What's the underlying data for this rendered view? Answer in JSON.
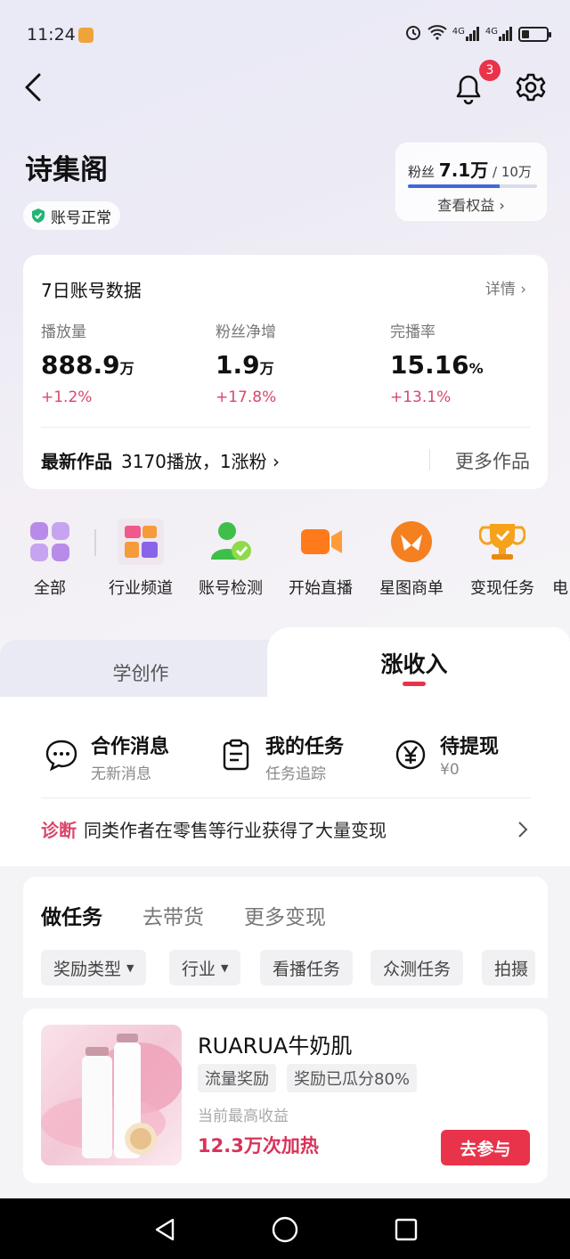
{
  "status_bar": {
    "time": "11:24",
    "net1": "4G",
    "net2": "4G"
  },
  "header": {
    "notification_count": "3"
  },
  "account": {
    "name": "诗集阁",
    "status": "账号正常"
  },
  "fans": {
    "label": "粉丝",
    "count": "7.1万",
    "target": "/ 10万",
    "progress": 0.71,
    "link": "查看权益 ›"
  },
  "data_card": {
    "title": "7日账号数据",
    "detail": "详情 ›",
    "stats": [
      {
        "label": "播放量",
        "value": "888.9",
        "unit": "万",
        "change": "+1.2%"
      },
      {
        "label": "粉丝净增",
        "value": "1.9",
        "unit": "万",
        "change": "+17.8%"
      },
      {
        "label": "完播率",
        "value": "15.16",
        "unit": "%",
        "change": "+13.1%"
      }
    ],
    "latest_label": "最新作品",
    "latest_info": "3170播放，1涨粉 ›",
    "more_works": "更多作品"
  },
  "shortcuts": [
    "全部",
    "行业频道",
    "账号检测",
    "开始直播",
    "星图商单",
    "变现任务",
    "电"
  ],
  "tabs": {
    "left": "学创作",
    "right": "涨收入"
  },
  "entries": [
    {
      "title": "合作消息",
      "sub": "无新消息",
      "icon": "chat-icon"
    },
    {
      "title": "我的任务",
      "sub": "任务追踪",
      "icon": "clipboard-icon"
    },
    {
      "title": "待提现",
      "sub": "¥0",
      "icon": "yen-icon"
    }
  ],
  "diagnosis": {
    "tag": "诊断",
    "text": "同类作者在零售等行业获得了大量变现"
  },
  "task_tabs": [
    "做任务",
    "去带货",
    "更多变现"
  ],
  "filters": [
    "奖励类型",
    "行业",
    "看播任务",
    "众测任务",
    "拍摄"
  ],
  "product": {
    "name": "RUARUA牛奶肌",
    "tags": [
      "流量奖励",
      "奖励已瓜分80%"
    ],
    "income_label": "当前最高收益",
    "income_value": "12.3万次加热",
    "button": "去参与"
  },
  "colors": {
    "accent": "#e8334a",
    "change": "#d9476a",
    "status_green": "#22b573"
  }
}
